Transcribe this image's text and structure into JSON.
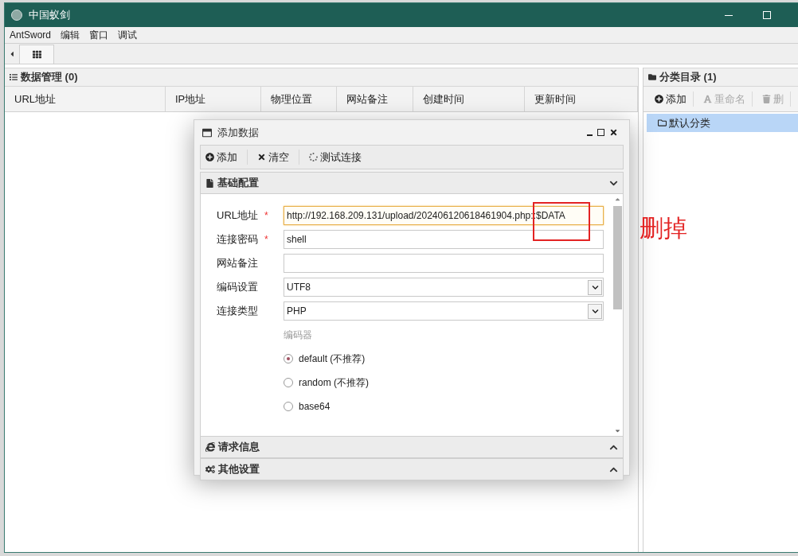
{
  "window": {
    "title": "中国蚁剑"
  },
  "menu": [
    "AntSword",
    "编辑",
    "窗口",
    "调试"
  ],
  "data_panel": {
    "title": "数据管理 (0)",
    "columns": [
      "URL地址",
      "IP地址",
      "物理位置",
      "网站备注",
      "创建时间",
      "更新时间"
    ]
  },
  "category_panel": {
    "title": "分类目录 (1)",
    "toolbar": [
      {
        "label": "添加",
        "disabled": false
      },
      {
        "label": "重命名",
        "disabled": true
      },
      {
        "label": "删",
        "disabled": true
      }
    ],
    "items": [
      {
        "label": "默认分类",
        "selected": true
      }
    ]
  },
  "dialog": {
    "title": "添加数据",
    "toolbar": [
      "添加",
      "清空",
      "测试连接"
    ],
    "sections": [
      {
        "title": "基础配置",
        "expanded": true
      },
      {
        "title": "请求信息",
        "expanded": false
      },
      {
        "title": "其他设置",
        "expanded": false
      }
    ],
    "fields": [
      {
        "label": "URL地址",
        "required_mark": "*",
        "kind": "text",
        "value": "http://192.168.209.131/upload/202406120618461904.php::$DATA",
        "focused": true
      },
      {
        "label": "连接密码",
        "required_mark": "*",
        "kind": "text",
        "value": "shell",
        "focused": false
      },
      {
        "label": "网站备注",
        "kind": "text",
        "focused": false
      },
      {
        "label": "编码设置",
        "kind": "select",
        "value": "UTF8"
      },
      {
        "label": "连接类型",
        "kind": "select",
        "value": "PHP"
      }
    ],
    "encoder_label": "编码器",
    "encoders": [
      {
        "label": "default (不推荐)",
        "selected": true
      },
      {
        "label": "random (不推荐)",
        "selected": false
      },
      {
        "label": "base64",
        "selected": false
      }
    ]
  },
  "annotation": {
    "text": "删掉"
  }
}
